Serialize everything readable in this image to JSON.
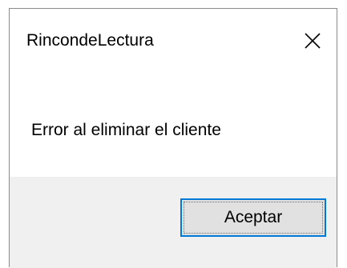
{
  "dialog": {
    "title": "RincondeLectura",
    "message": "Error al eliminar el cliente",
    "ok_label": "Aceptar",
    "close_icon": "close-icon"
  },
  "colors": {
    "accent_border": "#0078d7",
    "footer_bg": "#f0f0f0",
    "button_bg": "#e1e1e1"
  }
}
